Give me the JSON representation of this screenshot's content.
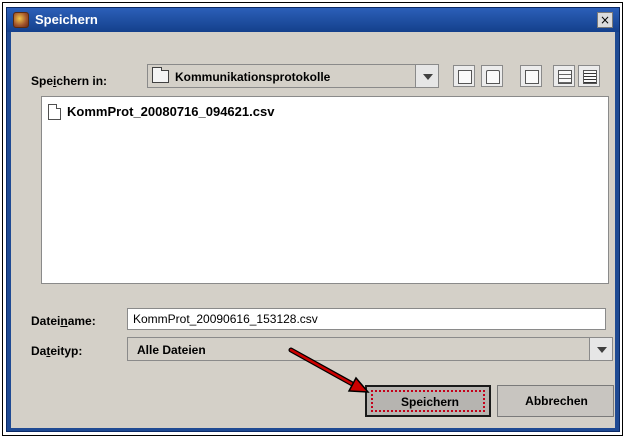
{
  "window": {
    "title": "Speichern",
    "close_glyph": "×"
  },
  "save_in": {
    "label_pre": "Spe",
    "label_mnemonic": "i",
    "label_post": "chern in:",
    "value": "Kommunikationsprotokolle"
  },
  "toolbar": {
    "buttons": [
      "up-folder-icon",
      "home-icon",
      "new-folder-icon",
      "list-view-icon",
      "details-view-icon"
    ]
  },
  "file_list": {
    "items": [
      {
        "name": "KommProt_20080716_094621.csv",
        "icon": "document-icon"
      }
    ]
  },
  "filename": {
    "label_pre": "Datei",
    "label_mnemonic": "n",
    "label_post": "ame:",
    "value": "KommProt_20090616_153128.csv"
  },
  "filetype": {
    "label_pre": "Da",
    "label_mnemonic": "t",
    "label_post": "eityp:",
    "value": "Alle Dateien"
  },
  "buttons": {
    "save": "Speichern",
    "cancel": "Abbrechen"
  },
  "annotation": {
    "arrow_color": "#cc0000"
  }
}
